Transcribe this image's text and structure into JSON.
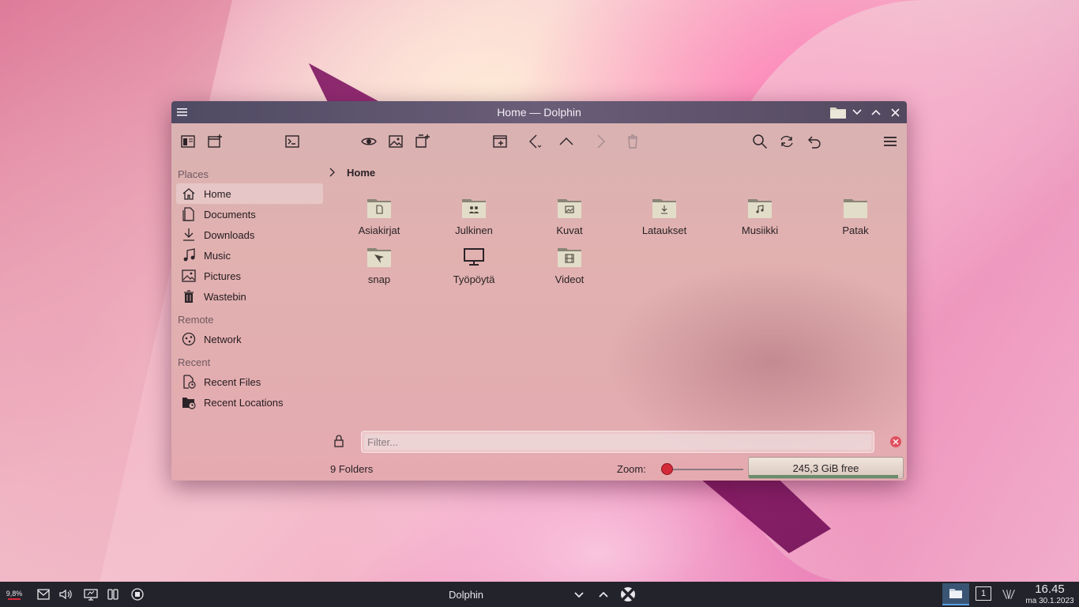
{
  "window": {
    "title": "Home — Dolphin"
  },
  "breadcrumb": {
    "current": "Home"
  },
  "sidebar": {
    "places_title": "Places",
    "places": [
      {
        "label": "Home",
        "icon": "home-icon"
      },
      {
        "label": "Documents",
        "icon": "documents-icon"
      },
      {
        "label": "Downloads",
        "icon": "downloads-icon"
      },
      {
        "label": "Music",
        "icon": "music-icon"
      },
      {
        "label": "Pictures",
        "icon": "pictures-icon"
      },
      {
        "label": "Wastebin",
        "icon": "wastebin-icon"
      }
    ],
    "remote_title": "Remote",
    "remote": [
      {
        "label": "Network",
        "icon": "network-icon"
      }
    ],
    "recent_title": "Recent",
    "recent": [
      {
        "label": "Recent Files",
        "icon": "recent-files-icon"
      },
      {
        "label": "Recent Locations",
        "icon": "recent-locations-icon"
      }
    ]
  },
  "items": [
    {
      "name": "Asiakirjat",
      "icon": "folder-documents-icon"
    },
    {
      "name": "Julkinen",
      "icon": "folder-public-icon"
    },
    {
      "name": "Kuvat",
      "icon": "folder-pictures-icon"
    },
    {
      "name": "Lataukset",
      "icon": "folder-download-icon"
    },
    {
      "name": "Musiikki",
      "icon": "folder-music-icon"
    },
    {
      "name": "Patak",
      "icon": "folder-icon"
    },
    {
      "name": "snap",
      "icon": "folder-snap-icon"
    },
    {
      "name": "Työpöytä",
      "icon": "desktop-icon"
    },
    {
      "name": "Videot",
      "icon": "folder-videos-icon"
    }
  ],
  "filter": {
    "placeholder": "Filter..."
  },
  "status": {
    "summary": "9 Folders",
    "zoom_label": "Zoom:",
    "free_space": "245,3 GiB free"
  },
  "taskbar": {
    "cpu": "9,8%",
    "active_task": "Dolphin",
    "desktop_number": "1",
    "time": "16.45",
    "date": "ma 30.1.2023"
  },
  "colors": {
    "titlebar": "#5a5069",
    "taskbar": "#23232b",
    "accent": "#d32a3a"
  }
}
